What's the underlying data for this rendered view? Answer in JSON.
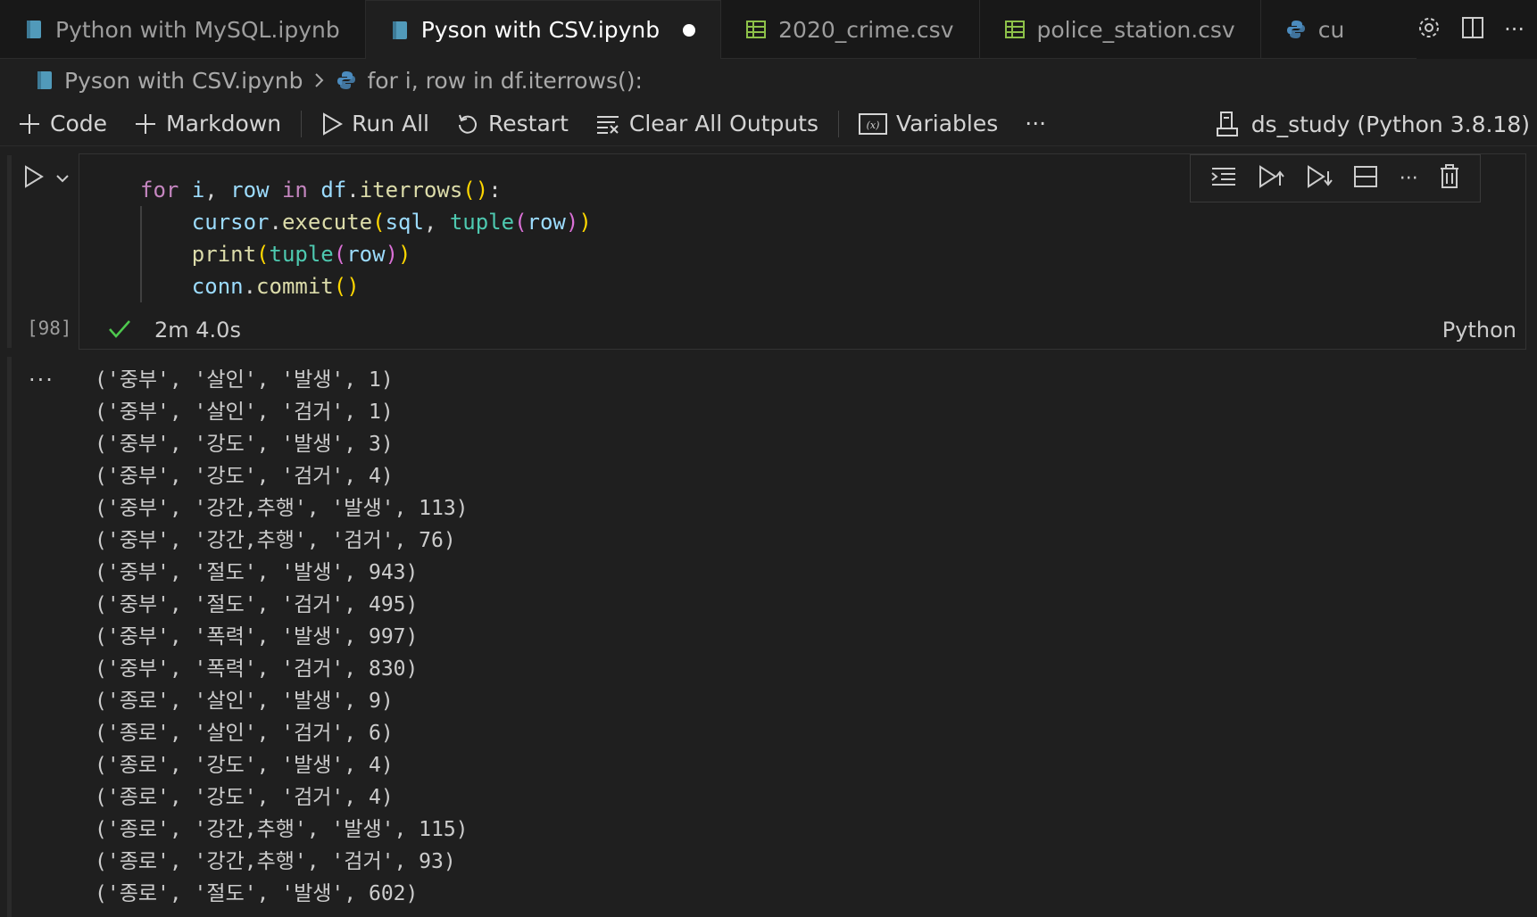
{
  "tabs": [
    {
      "label": "Python with MySQL.ipynb",
      "icon": "notebook-icon",
      "active": false
    },
    {
      "label": "Pyson with CSV.ipynb",
      "icon": "notebook-icon",
      "active": true,
      "unsaved": true
    },
    {
      "label": "2020_crime.csv",
      "icon": "csv-table-icon",
      "active": false
    },
    {
      "label": "police_station.csv",
      "icon": "csv-table-icon",
      "active": false
    },
    {
      "label": "cu",
      "icon": "python-icon",
      "active": false
    }
  ],
  "breadcrumb": {
    "file": "Pyson with CSV.ipynb",
    "cell": "for i, row in df.iterrows():"
  },
  "toolbar": {
    "code": "Code",
    "markdown": "Markdown",
    "run_all": "Run All",
    "restart": "Restart",
    "clear_outputs": "Clear All Outputs",
    "variables": "Variables",
    "more": "···",
    "kernel": "ds_study (Python 3.8.18)"
  },
  "cell": {
    "execution_count": "[98]",
    "duration": "2m 4.0s",
    "language": "Python",
    "code_lines": [
      "for i, row in df.iterrows():",
      "    cursor.execute(sql, tuple(row))",
      "    print(tuple(row))",
      "    conn.commit()"
    ]
  },
  "output": {
    "more": "···",
    "lines": [
      "('중부', '살인', '발생', 1)",
      "('중부', '살인', '검거', 1)",
      "('중부', '강도', '발생', 3)",
      "('중부', '강도', '검거', 4)",
      "('중부', '강간,추행', '발생', 113)",
      "('중부', '강간,추행', '검거', 76)",
      "('중부', '절도', '발생', 943)",
      "('중부', '절도', '검거', 495)",
      "('중부', '폭력', '발생', 997)",
      "('중부', '폭력', '검거', 830)",
      "('종로', '살인', '발생', 9)",
      "('종로', '살인', '검거', 6)",
      "('종로', '강도', '발생', 4)",
      "('종로', '강도', '검거', 4)",
      "('종로', '강간,추행', '발생', 115)",
      "('종로', '강간,추행', '검거', 93)",
      "('종로', '절도', '발생', 602)"
    ]
  },
  "colors": {
    "background": "#1f1f1f",
    "tabbar": "#181818",
    "keyword": "#c586c0",
    "variable": "#9cdcfe",
    "function": "#dcdcaa",
    "builtin": "#4ec9b0",
    "success": "#4ec94e"
  }
}
